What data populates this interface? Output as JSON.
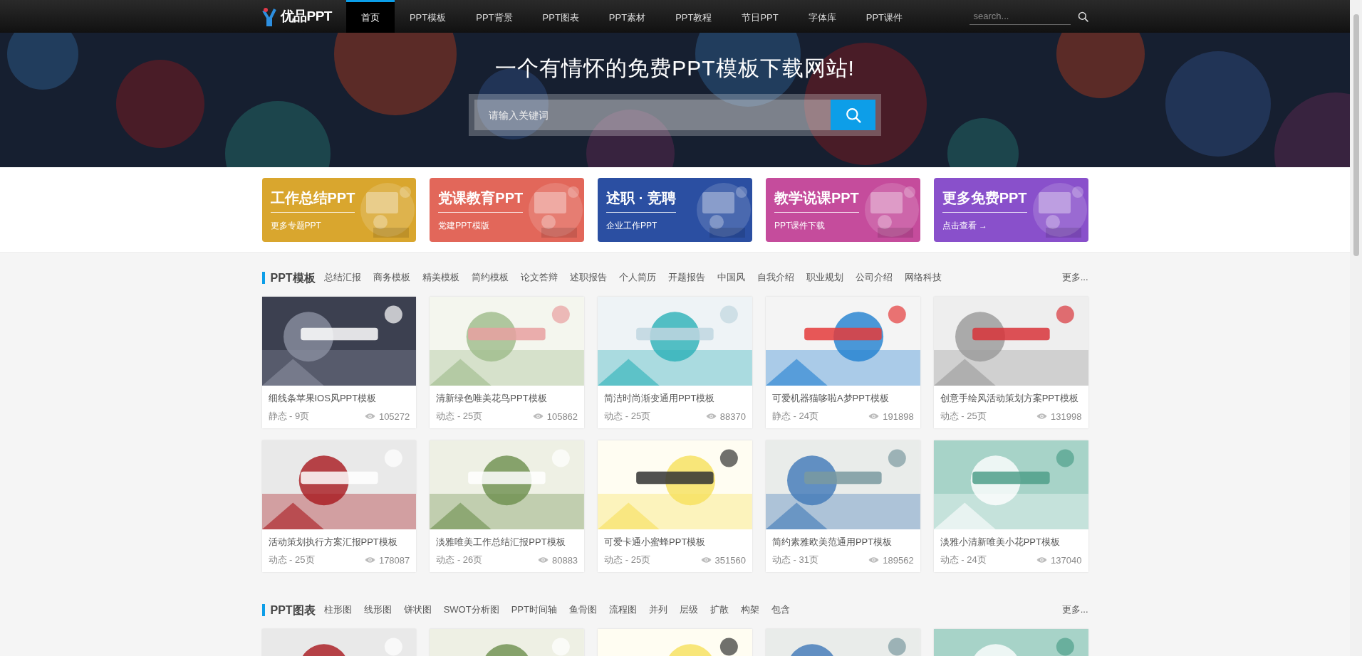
{
  "nav": {
    "logo": "优品PPT",
    "items": [
      {
        "label": "首页",
        "selected": true
      },
      {
        "label": "PPT模板",
        "selected": false
      },
      {
        "label": "PPT背景",
        "selected": false
      },
      {
        "label": "PPT图表",
        "selected": false
      },
      {
        "label": "PPT素材",
        "selected": false
      },
      {
        "label": "PPT教程",
        "selected": false
      },
      {
        "label": "节日PPT",
        "selected": false
      },
      {
        "label": "字体库",
        "selected": false
      },
      {
        "label": "PPT课件",
        "selected": false
      }
    ],
    "search": {
      "placeholder": "search..."
    }
  },
  "hero": {
    "title": "一个有情怀的免费PPT模板下载网站!",
    "search": {
      "placeholder": "请输入关键词"
    }
  },
  "banners": [
    {
      "title": "工作总结PPT",
      "subtitle": "更多专题PPT",
      "color": "#d9a62e"
    },
    {
      "title": "党课教育PPT",
      "subtitle": "党建PPT模版",
      "color": "#e2675a"
    },
    {
      "title": "述职 · 竞聘",
      "subtitle": "企业工作PPT",
      "color": "#2b4fa2"
    },
    {
      "title": "教学说课PPT",
      "subtitle": "PPT课件下载",
      "color": "#c54c9c"
    },
    {
      "title": "更多免费PPT",
      "subtitle": "点击查看 →",
      "color": "#8950cb"
    }
  ],
  "sections": [
    {
      "title": "PPT模板",
      "tags": [
        "总结汇报",
        "商务模板",
        "精美模板",
        "简约模板",
        "论文答辩",
        "述职报告",
        "个人简历",
        "开题报告",
        "中国风",
        "自我介绍",
        "职业规划",
        "公司介绍",
        "网络科技"
      ],
      "more": "更多...",
      "cards": [
        {
          "kind": "card",
          "title": "细线条苹果IOS风PPT模板",
          "meta": "静态 - 9页",
          "views": "105272"
        },
        {
          "kind": "card",
          "title": "清新绿色唯美花鸟PPT模板",
          "meta": "动态 - 25页",
          "views": "105862"
        },
        {
          "kind": "card",
          "title": "简洁时尚渐变通用PPT模板",
          "meta": "动态 - 25页",
          "views": "88370"
        },
        {
          "kind": "card",
          "title": "可爱机器猫哆啦A梦PPT模板",
          "meta": "静态 - 24页",
          "views": "191898"
        },
        {
          "kind": "card",
          "title": "创意手绘风活动策划方案PPT模板",
          "meta": "动态 - 25页",
          "views": "131998"
        },
        {
          "kind": "card",
          "title": "活动策划执行方案汇报PPT模板",
          "meta": "动态 - 25页",
          "views": "178087"
        },
        {
          "kind": "card",
          "title": "淡雅唯美工作总结汇报PPT模板",
          "meta": "动态 - 26页",
          "views": "80883"
        },
        {
          "kind": "card",
          "title": "可爱卡通小蜜蜂PPT模板",
          "meta": "动态 - 25页",
          "views": "351560"
        },
        {
          "kind": "card",
          "title": "简约素雅欧美范通用PPT模板",
          "meta": "动态 - 31页",
          "views": "189562"
        },
        {
          "kind": "card",
          "title": "淡雅小清新唯美小花PPT模板",
          "meta": "动态 - 24页",
          "views": "137040"
        }
      ]
    },
    {
      "title": "PPT图表",
      "tags": [
        "柱形图",
        "线形图",
        "饼状图",
        "SWOT分析图",
        "PPT时间轴",
        "鱼骨图",
        "流程图",
        "并列",
        "层级",
        "扩散",
        "构架",
        "包含"
      ],
      "more": "更多...",
      "cards": [
        {
          "kind": "picture"
        },
        {
          "kind": "picture"
        },
        {
          "kind": "picture"
        },
        {
          "kind": "picture"
        },
        {
          "kind": "picture"
        }
      ]
    }
  ]
}
